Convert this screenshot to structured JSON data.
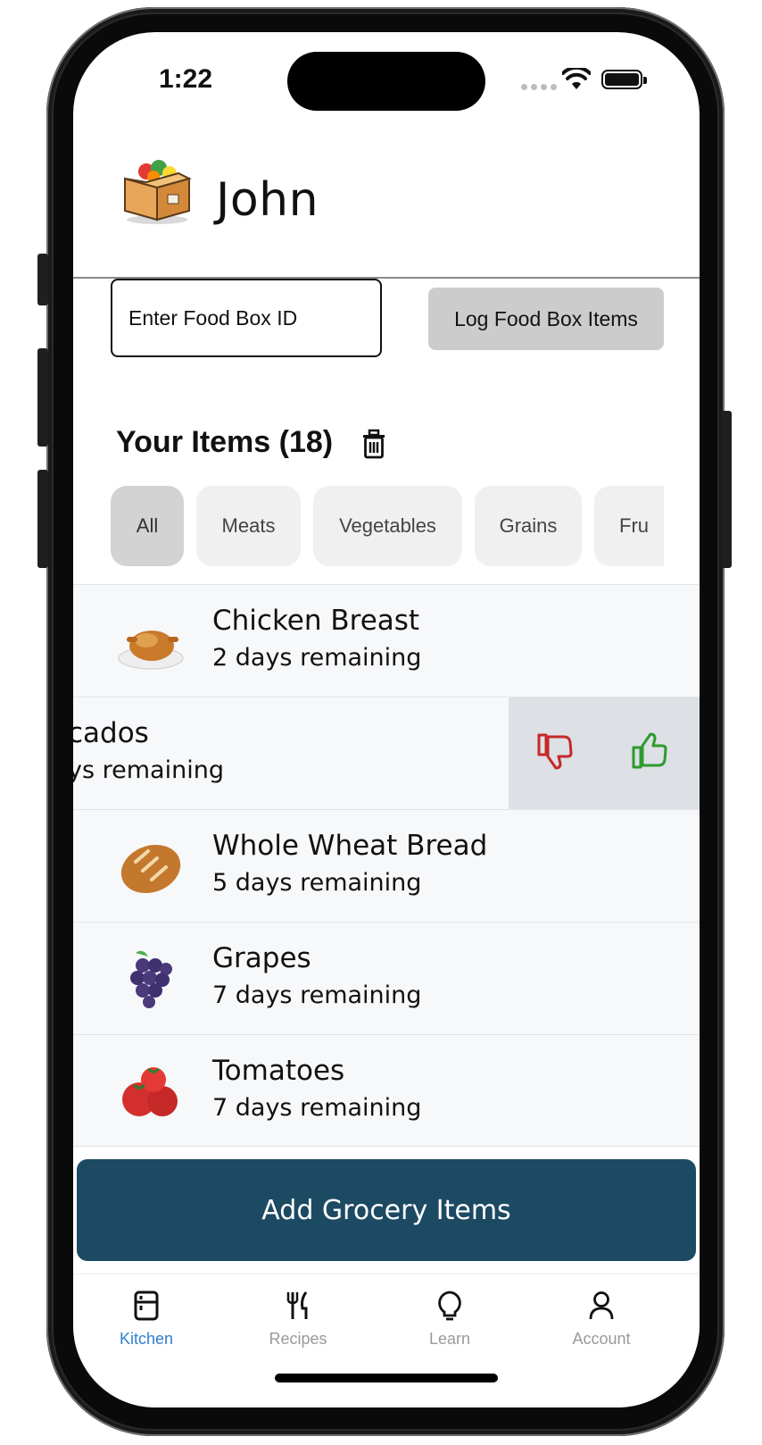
{
  "status": {
    "time": "1:22"
  },
  "header": {
    "user_name": "John"
  },
  "food_box": {
    "placeholder": "Enter Food Box ID",
    "log_label": "Log Food Box Items"
  },
  "items_section": {
    "title": "Your Items (18)"
  },
  "categories": [
    {
      "label": "All",
      "active": true
    },
    {
      "label": "Meats",
      "active": false
    },
    {
      "label": "Vegetables",
      "active": false
    },
    {
      "label": "Grains",
      "active": false
    },
    {
      "label": "Fru",
      "active": false
    }
  ],
  "items": [
    {
      "name": "Chicken Breast",
      "remaining": "2 days remaining",
      "icon": "roast-chicken-icon"
    },
    {
      "name": "cados",
      "remaining": "ys remaining",
      "icon": "avocado-icon",
      "swiped": true
    },
    {
      "name": "Whole Wheat Bread",
      "remaining": "5 days remaining",
      "icon": "bread-icon"
    },
    {
      "name": "Grapes",
      "remaining": "7 days remaining",
      "icon": "grapes-icon"
    },
    {
      "name": "Tomatoes",
      "remaining": "7 days remaining",
      "icon": "tomatoes-icon"
    }
  ],
  "add_button": {
    "label": "Add Grocery Items"
  },
  "tabs": [
    {
      "label": "Kitchen",
      "icon": "fridge-icon",
      "active": true
    },
    {
      "label": "Recipes",
      "icon": "fork-knife-icon",
      "active": false
    },
    {
      "label": "Learn",
      "icon": "lightbulb-icon",
      "active": false
    },
    {
      "label": "Account",
      "icon": "person-icon",
      "active": false
    }
  ],
  "colors": {
    "accent": "#2f7fd0",
    "primary_button": "#1d4a63",
    "thumb_down": "#c62828",
    "thumb_up": "#2e9a2e"
  }
}
